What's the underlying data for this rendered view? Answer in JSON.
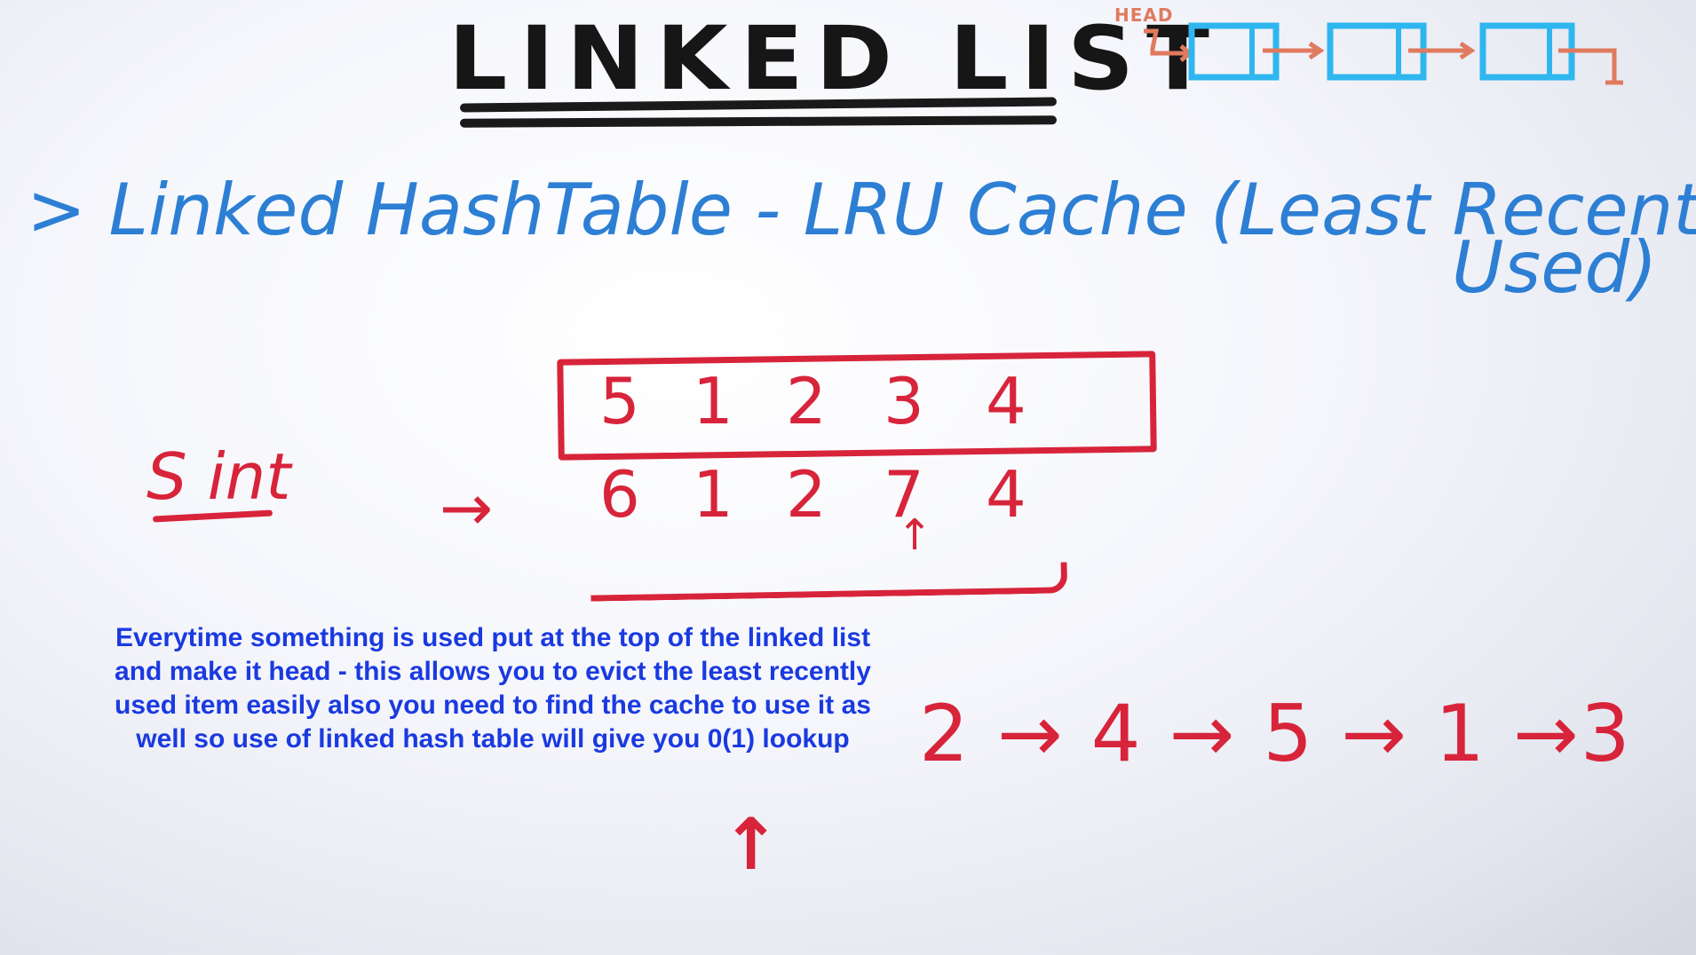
{
  "title": "LINKED LIST",
  "diagram": {
    "head_label": "HEAD"
  },
  "subtitle": {
    "line1": "> Linked HashTable - LRU Cache (Least Recently",
    "line2": "Used)"
  },
  "cache": {
    "row1": [
      "5",
      "1",
      "2",
      "3",
      "4"
    ],
    "row2": [
      "6",
      "1",
      "2",
      "7",
      "4"
    ],
    "set_label": "S int",
    "arrow": "→",
    "pointer": "↑"
  },
  "note": {
    "lines": [
      "Everytime something is used put at the top of the linked list",
      "and make it head - this allows you to evict the least recently",
      "used item easily also you need to find the cache to use it as",
      "well so use of linked hash table will give you 0(1) lookup"
    ]
  },
  "chain": "2 → 4 → 5 → 1 →3",
  "up_arrow": "↑",
  "colors": {
    "ink_black": "#161616",
    "ink_blue": "#2d7fd4",
    "ink_red": "#d7243a",
    "note_blue": "#1a3ae0",
    "node_blue": "#2fb6ef",
    "pointer_orange": "#e07a5f"
  }
}
